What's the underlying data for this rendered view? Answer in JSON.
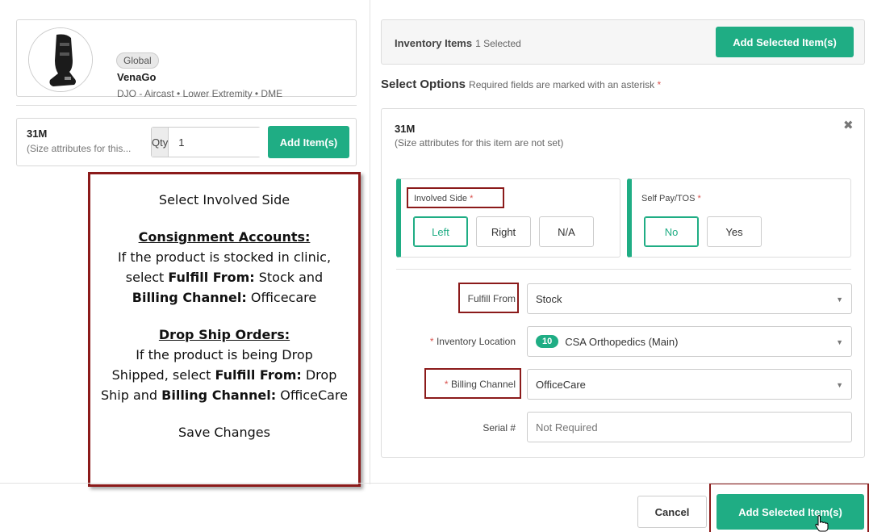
{
  "product": {
    "badge": "Global",
    "name": "VenaGo",
    "subtitle": "DJO - Aircast • Lower Extremity • DME"
  },
  "item": {
    "size": "31M",
    "size_note": "(Size attributes for this...",
    "qty_label": "Qty",
    "qty_value": "1",
    "add_button": "Add Item(s)"
  },
  "callout": {
    "title": "Select Involved Side",
    "consignment_heading": "Consignment Accounts:",
    "consignment_l1": "If the product is stocked in clinic,",
    "consignment_l2a": "select ",
    "consignment_l2b": "Fulfill From:",
    "consignment_l2c": " Stock and",
    "consignment_l3a": "Billing Channel:",
    "consignment_l3b": " Officecare",
    "dropship_heading": "Drop Ship Orders:",
    "dropship_l1": "If the product is being Drop",
    "dropship_l2a": "Shipped, select ",
    "dropship_l2b": "Fulfill From:",
    "dropship_l2c": " Drop",
    "dropship_l3a": "Ship and ",
    "dropship_l3b": "Billing Channel:",
    "dropship_l3c": " OfficeCare",
    "save": "Save Changes"
  },
  "inventory": {
    "title": "Inventory Items",
    "count": "1 Selected",
    "add_selected": "Add Selected Item(s)"
  },
  "select_options": {
    "title": "Select Options",
    "required_note": "Required fields are marked with an asterisk",
    "asterisk": "*"
  },
  "option_card": {
    "size": "31M",
    "note": "(Size attributes for this item are not set)",
    "close": "✖",
    "involved_side": {
      "label": "Involved Side",
      "options": [
        "Left",
        "Right",
        "N/A"
      ],
      "selected": "Left"
    },
    "self_pay": {
      "label": "Self Pay/TOS",
      "options": [
        "No",
        "Yes"
      ],
      "selected": "No"
    },
    "fulfill_from": {
      "label": "Fulfill From",
      "value": "Stock"
    },
    "inventory_location": {
      "label": "Inventory Location",
      "badge": "10",
      "value": "CSA Orthopedics (Main)"
    },
    "billing_channel": {
      "label": "Billing Channel",
      "value": "OfficeCare"
    },
    "serial": {
      "label": "Serial #",
      "placeholder": "Not Required"
    }
  },
  "footer": {
    "cancel": "Cancel",
    "add_selected": "Add Selected Item(s)"
  },
  "colors": {
    "accent": "#1fad84",
    "annotation": "#8b1a1a",
    "required": "#d9534f"
  }
}
